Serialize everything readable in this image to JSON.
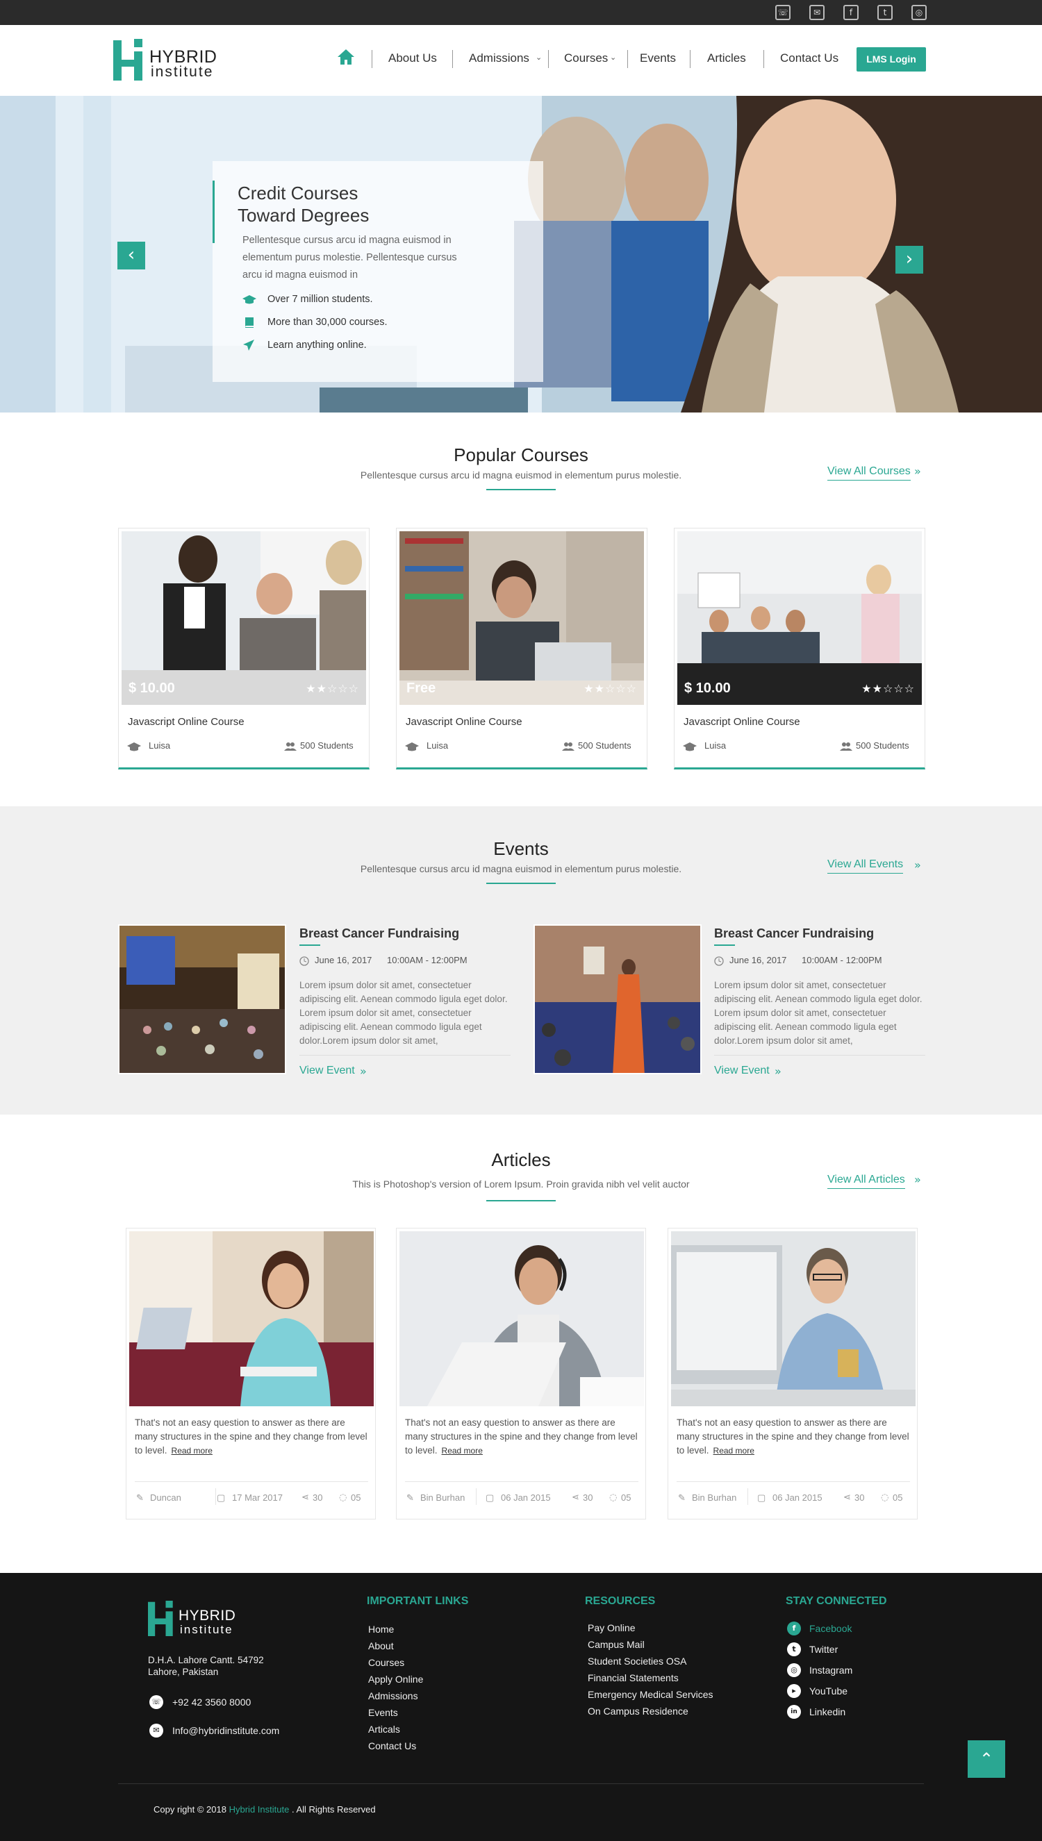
{
  "topbar": {
    "icons": [
      "phone-icon",
      "mail-icon",
      "facebook-icon",
      "twitter-icon",
      "instagram-icon"
    ],
    "glyphs": [
      "☏",
      "✉",
      "f",
      "t",
      "◎"
    ]
  },
  "header": {
    "logo": {
      "line1": "HYBRID",
      "line2": "institute"
    },
    "nav": [
      "About Us",
      "Admissions",
      "Courses",
      "Events",
      "Articles",
      "Contact Us"
    ],
    "nav_home_icon": "home-icon",
    "lms_button": "LMS Login"
  },
  "hero": {
    "title_line1": "Credit Courses",
    "title_line2": "Toward Degrees",
    "description": "Pellentesque cursus arcu id magna euismod in elementum purus molestie. Pellentesque cursus arcu id magna euismod in",
    "bullets": [
      "Over 7 million students.",
      "More than 30,000 courses.",
      "Learn anything online."
    ],
    "prev_glyph": "‹",
    "next_glyph": "›"
  },
  "popular": {
    "title": "Popular Courses",
    "subtitle": "Pellentesque cursus arcu id magna euismod in elementum purus molestie.",
    "view_all": "View All Courses",
    "courses": [
      {
        "price": "$ 10.00",
        "rating": 2,
        "title": "Javascript Online Course",
        "teacher": "Luisa",
        "students": "500 Students"
      },
      {
        "price": "Free",
        "rating": 2,
        "title": "Javascript Online Course",
        "teacher": "Luisa",
        "students": "500 Students"
      },
      {
        "price": "$ 10.00",
        "rating": 2,
        "title": "Javascript Online Course",
        "teacher": "Luisa",
        "students": "500 Students"
      }
    ]
  },
  "events": {
    "title": "Events",
    "subtitle": "Pellentesque cursus arcu id magna euismod in elementum purus molestie.",
    "view_all": "View All Events",
    "items": [
      {
        "title": "Breast Cancer Fundraising",
        "date": "June 16, 2017",
        "time": "10:00AM - 12:00PM",
        "text": "Lorem ipsum dolor sit amet, consectetuer adipiscing elit. Aenean commodo ligula eget dolor. Lorem ipsum dolor sit amet, consectetuer adipiscing elit. Aenean commodo ligula eget dolor.Lorem ipsum dolor sit amet,",
        "link": "View Event"
      },
      {
        "title": "Breast Cancer Fundraising",
        "date": "June 16, 2017",
        "time": "10:00AM - 12:00PM",
        "text": "Lorem ipsum dolor sit amet, consectetuer adipiscing elit. Aenean commodo ligula eget dolor. Lorem ipsum dolor sit amet, consectetuer adipiscing elit. Aenean commodo ligula eget dolor.Lorem ipsum dolor sit amet,",
        "link": "View Event"
      }
    ]
  },
  "articles": {
    "title": "Articles",
    "subtitle": "This is Photoshop's version  of Lorem Ipsum. Proin gravida nibh vel velit auctor",
    "view_all": "View All Articles",
    "items": [
      {
        "text": "That's not an easy question to answer as there are many structures in the spine and they change from level to level.",
        "read_more": "Read more",
        "author": "Duncan",
        "date": "17 Mar 2017",
        "shares": "30",
        "comments": "05"
      },
      {
        "text": "That's not an easy question to answer as there are many structures in the spine and they change from level to level.",
        "read_more": "Read more",
        "author": "Bin Burhan",
        "date": "06 Jan 2015",
        "shares": "30",
        "comments": "05"
      },
      {
        "text": "That's not an easy question to answer as there are many structures in the spine and they change from level to level.",
        "read_more": "Read more",
        "author": "Bin Burhan",
        "date": "06 Jan 2015",
        "shares": "30",
        "comments": "05"
      }
    ]
  },
  "footer": {
    "address_line1": "D.H.A. Lahore Cantt. 54792",
    "address_line2": "Lahore, Pakistan",
    "phone": "+92 42 3560 8000",
    "email": "Info@hybridinstitute.com",
    "important_links_title": "IMPORTANT LINKS",
    "important_links": [
      "Home",
      "About",
      "Courses",
      "Apply Online",
      "Admissions",
      "Events",
      "Articals",
      "Contact Us"
    ],
    "resources_title": "RESOURCES",
    "resources": [
      "Pay Online",
      "Campus Mail",
      "Student Societies OSA",
      "Financial Statements",
      "Emergency Medical Services",
      "On Campus Residence"
    ],
    "stay_title": "STAY CONNECTED",
    "social": [
      "Facebook",
      "Twitter",
      "Instagram",
      "YouTube",
      "Linkedin"
    ],
    "social_glyphs": [
      "f",
      "t",
      "◎",
      "▸",
      "in"
    ],
    "copyright_pre": "Copy right © 2018",
    "copyright_brand": "Hybrid Institute",
    "copyright_post": ". All Rights Reserved",
    "to_top_glyph": "⌃"
  },
  "colors": {
    "accent": "#2aa792",
    "topbar": "#2b2b2b",
    "footer": "#151515",
    "events_bg": "#f0f0f0"
  }
}
